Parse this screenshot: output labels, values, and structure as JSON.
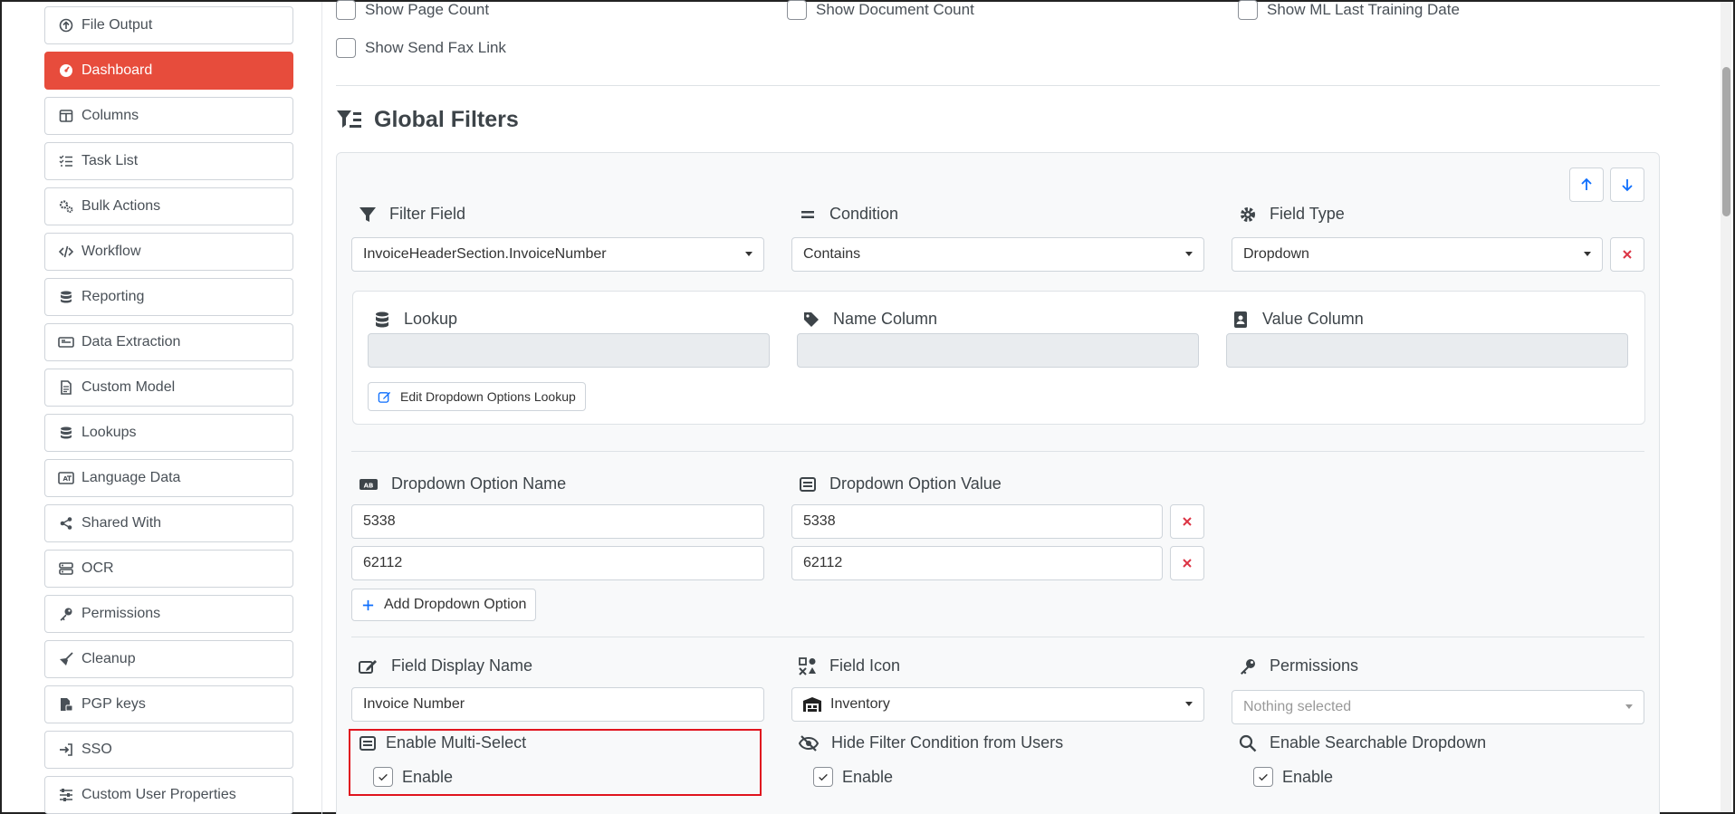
{
  "sidebar": {
    "items": [
      {
        "label": "File Output",
        "icon": "circle-arrow-up-icon",
        "active": false
      },
      {
        "label": "Dashboard",
        "icon": "gauge-icon",
        "active": true
      },
      {
        "label": "Columns",
        "icon": "columns-icon",
        "active": false
      },
      {
        "label": "Task List",
        "icon": "task-list-icon",
        "active": false
      },
      {
        "label": "Bulk Actions",
        "icon": "gears-icon",
        "active": false
      },
      {
        "label": "Workflow",
        "icon": "code-icon",
        "active": false
      },
      {
        "label": "Reporting",
        "icon": "database-icon",
        "active": false
      },
      {
        "label": "Data Extraction",
        "icon": "scan-icon",
        "active": false
      },
      {
        "label": "Custom Model",
        "icon": "file-icon",
        "active": false
      },
      {
        "label": "Lookups",
        "icon": "database-icon",
        "active": false
      },
      {
        "label": "Language Data",
        "icon": "language-icon",
        "active": false
      },
      {
        "label": "Shared With",
        "icon": "share-icon",
        "active": false
      },
      {
        "label": "OCR",
        "icon": "server-icon",
        "active": false
      },
      {
        "label": "Permissions",
        "icon": "key-icon",
        "active": false
      },
      {
        "label": "Cleanup",
        "icon": "broom-icon",
        "active": false
      },
      {
        "label": "PGP keys",
        "icon": "file-lock-icon",
        "active": false
      },
      {
        "label": "SSO",
        "icon": "sign-in-icon",
        "active": false
      },
      {
        "label": "Custom User Properties",
        "icon": "sliders-icon",
        "active": false
      }
    ]
  },
  "top_options": {
    "show_page_count": "Show Page Count",
    "show_document_count": "Show Document Count",
    "show_ml_last_training_date": "Show ML Last Training Date",
    "show_send_fax_link": "Show Send Fax Link"
  },
  "global_filters": {
    "title": "Global Filters",
    "filter_field_label": "Filter Field",
    "filter_field_value": "InvoiceHeaderSection.InvoiceNumber",
    "condition_label": "Condition",
    "condition_value": "Contains",
    "field_type_label": "Field Type",
    "field_type_value": "Dropdown",
    "lookup_label": "Lookup",
    "name_column_label": "Name Column",
    "value_column_label": "Value Column",
    "edit_lookup_button": "Edit Dropdown Options Lookup",
    "option_name_label": "Dropdown Option Name",
    "option_value_label": "Dropdown Option Value",
    "options": [
      {
        "name": "5338",
        "value": "5338"
      },
      {
        "name": "62112",
        "value": "62112"
      }
    ],
    "add_option_button": "Add Dropdown Option",
    "display_name_label": "Field Display Name",
    "display_name_value": "Invoice Number",
    "field_icon_label": "Field Icon",
    "field_icon_value": "Inventory",
    "permissions_label": "Permissions",
    "permissions_placeholder": "Nothing selected",
    "multi_select_label": "Enable Multi-Select",
    "multi_select_enable": "Enable",
    "hide_condition_label": "Hide Filter Condition from Users",
    "hide_condition_enable": "Enable",
    "searchable_label": "Enable Searchable Dropdown",
    "searchable_enable": "Enable"
  },
  "colors": {
    "accent_red": "#e74c3c",
    "primary_blue": "#0d6efd",
    "danger_red": "#dc3545",
    "highlight_border": "#e0141e"
  }
}
